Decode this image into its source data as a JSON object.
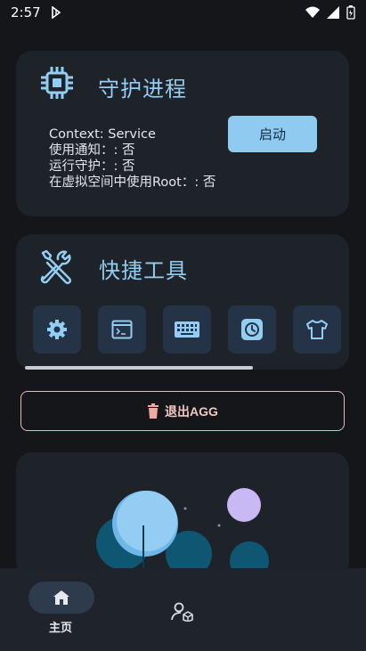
{
  "status_bar": {
    "time": "2:57"
  },
  "daemon": {
    "title": "守护进程",
    "context": "Context: Service",
    "notify": "使用通知：: 否",
    "guard": "运行守护：: 否",
    "virtual": "在虚拟空间中使用Root：: 否",
    "start_label": "启动"
  },
  "tools": {
    "title": "快捷工具",
    "items": [
      {
        "icon": "settings-icon"
      },
      {
        "icon": "terminal-icon"
      },
      {
        "icon": "keyboard-icon"
      },
      {
        "icon": "clock-icon"
      },
      {
        "icon": "shirt-icon"
      }
    ]
  },
  "exit_label": "退出AGG",
  "nav": {
    "home_label": "主页"
  },
  "colors": {
    "background": "#14161a",
    "card": "#1e2229",
    "accent": "#8fcaf0",
    "title": "#93cdf3",
    "exit_border": "#e7b9b6"
  }
}
